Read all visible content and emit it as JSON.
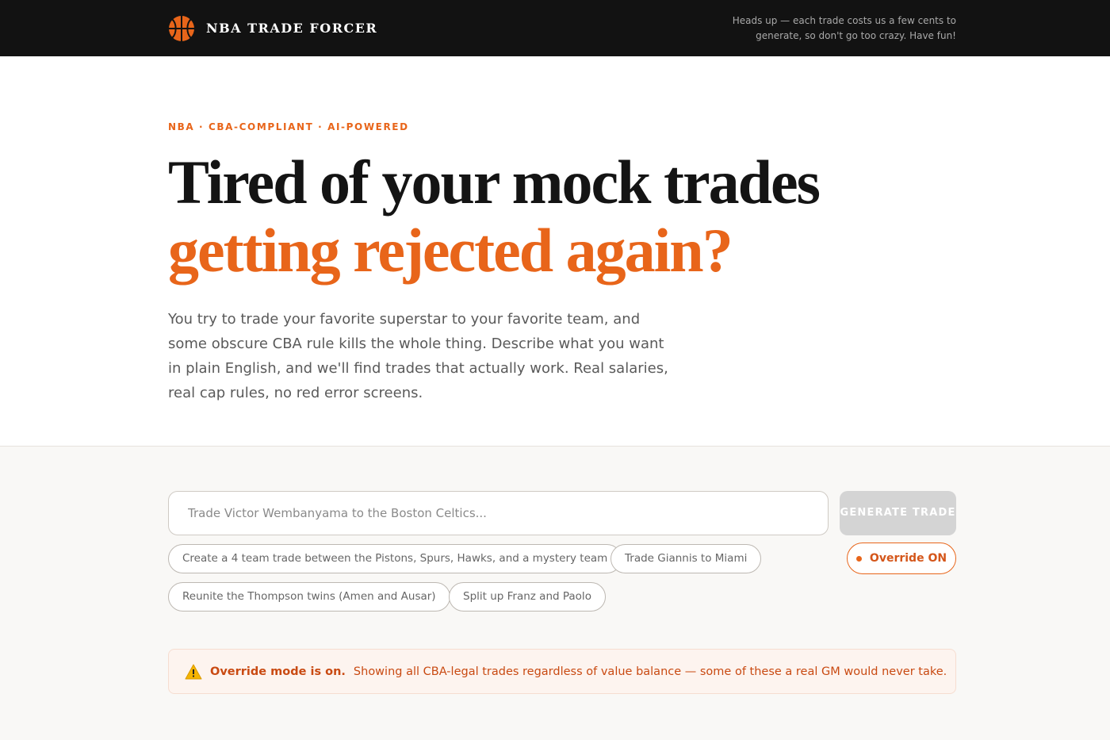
{
  "header": {
    "brand": "NBA TRADE FORCER",
    "note": "Heads up — each trade costs us a few cents to generate, so don't go too crazy. Have fun!"
  },
  "hero": {
    "eyebrow": "NBA · CBA-COMPLIANT · AI-POWERED",
    "headline_line1": "Tired of your mock trades",
    "headline_line2": "getting rejected again?",
    "description": "You try to trade your favorite superstar to your favorite team, and some obscure CBA rule kills the whole thing. Describe what you want in plain English, and we'll find trades that actually work. Real salaries, real cap rules, no red error screens."
  },
  "composer": {
    "value": "",
    "placeholder": "Trade Victor Wembanyama to the Boston Celtics...",
    "generate_label": "GENERATE TRADE"
  },
  "suggestions": [
    "Create a 4 team trade between the Pistons, Spurs, Hawks, and a mystery team",
    "Trade Giannis to Miami",
    "Reunite the Thompson twins (Amen and Ausar)",
    "Split up Franz and Paolo"
  ],
  "override": {
    "label": "Override ON"
  },
  "alert": {
    "title": "Override mode is on.",
    "message": "Showing all CBA-legal trades regardless of value balance — some of these a real GM would never take."
  },
  "colors": {
    "accent": "#e8651a",
    "topbar": "#121212",
    "alert_bg": "#fdf4ef"
  },
  "icons": {
    "logo": "basketball-icon",
    "alert": "warning-icon",
    "override_indicator": "status-dot-icon"
  }
}
